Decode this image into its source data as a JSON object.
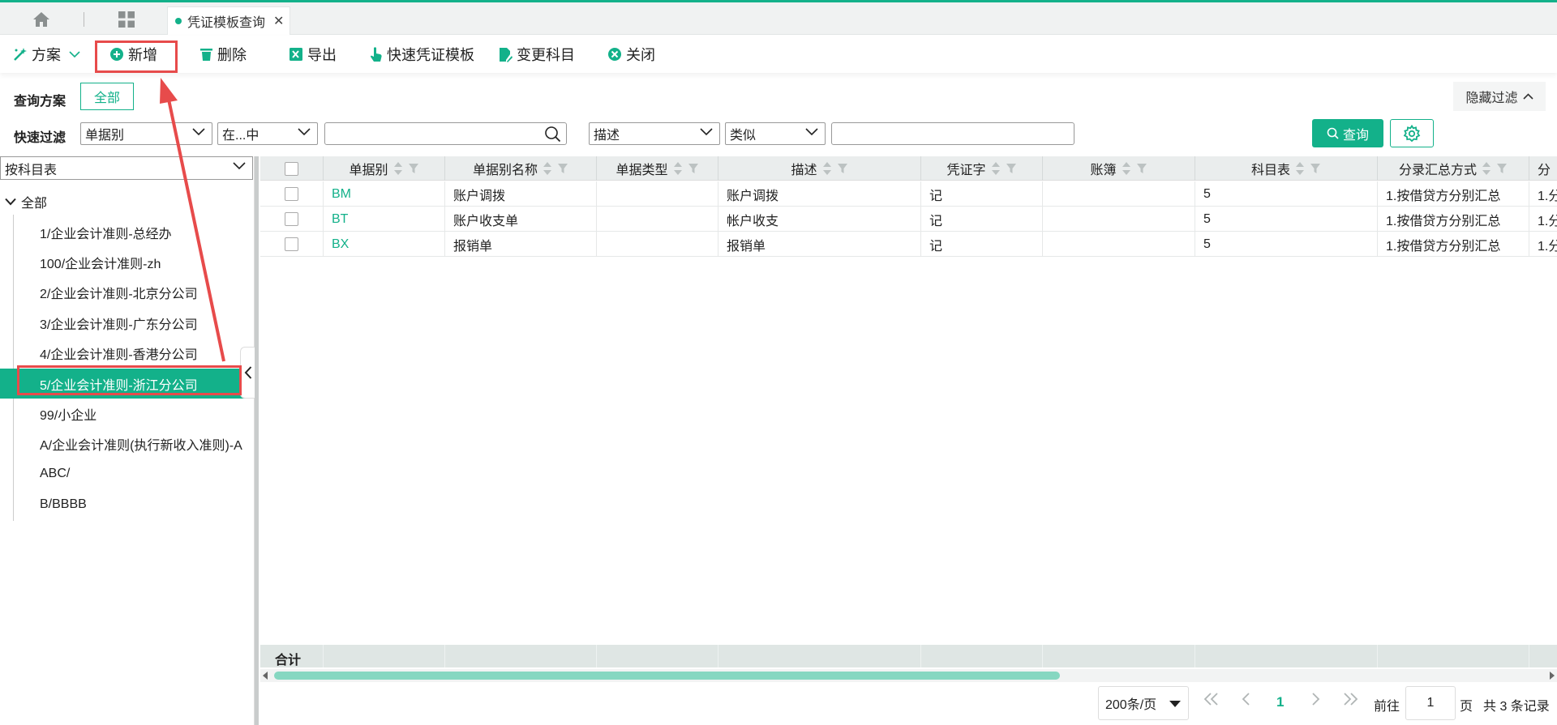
{
  "tabs": {
    "active_label": "凭证模板查询",
    "close_glyph": "✕"
  },
  "toolbar": {
    "scheme": "方案",
    "add": "新增",
    "delete": "删除",
    "export": "导出",
    "quick_template": "快速凭证模板",
    "change_subject": "变更科目",
    "close": "关闭"
  },
  "query": {
    "scheme_label": "查询方案",
    "all_button": "全部",
    "hide_filter": "隐藏过滤",
    "quick_filter_label": "快速过滤",
    "field1": "单据别",
    "op1": "在...中",
    "value1": "",
    "field2": "描述",
    "op2": "类似",
    "value2": "",
    "search_button": "查询"
  },
  "tree": {
    "selector": "按科目表",
    "root": "全部",
    "items": [
      "1/企业会计准则-总经办",
      "100/企业会计准则-zh",
      "2/企业会计准则-北京分公司",
      "3/企业会计准则-广东分公司",
      "4/企业会计准则-香港分公司",
      "5/企业会计准则-浙江分公司",
      "99/小企业",
      "A/企业会计准则(执行新收入准则)-A",
      "ABC/",
      "B/BBBB"
    ],
    "selected_index": 5
  },
  "grid": {
    "columns": [
      "单据别",
      "单据别名称",
      "单据类型",
      "描述",
      "凭证字",
      "账簿",
      "科目表",
      "分录汇总方式",
      "分"
    ],
    "rows": [
      [
        "BM",
        "账户调拨",
        "",
        "账户调拨",
        "记",
        "",
        "5",
        "1.按借贷方分别汇总",
        "1.分"
      ],
      [
        "BT",
        "账户收支单",
        "",
        "帐户收支",
        "记",
        "",
        "5",
        "1.按借贷方分别汇总",
        "1.分"
      ],
      [
        "BX",
        "报销单",
        "",
        "报销单",
        "记",
        "",
        "5",
        "1.按借贷方分别汇总",
        "1.分"
      ]
    ],
    "total_label": "合计"
  },
  "pager": {
    "page_size": "200条/页",
    "current_page": "1",
    "goto_label": "前往",
    "goto_value": "1",
    "page_unit": "页",
    "total_text": "共 3 条记录"
  },
  "colors": {
    "accent": "#13b18a",
    "annotation": "#e74b4b"
  }
}
